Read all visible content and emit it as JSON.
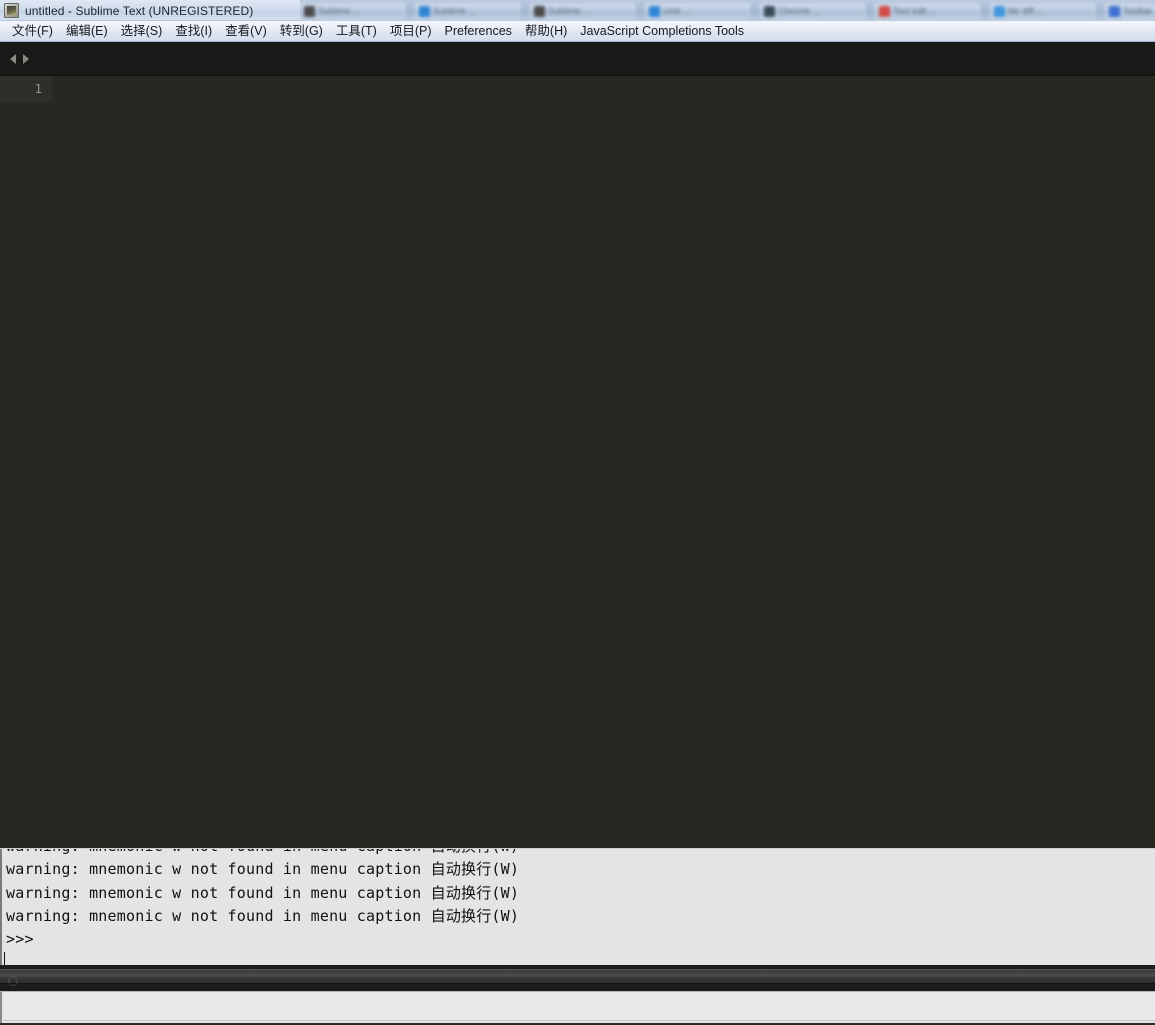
{
  "window": {
    "title": "untitled - Sublime Text (UNREGISTERED)",
    "app_icon": "sublime-text-icon"
  },
  "taskbar": {
    "background_windows": [
      {
        "label": "Sublime ..."
      },
      {
        "label": "Sublime ..."
      },
      {
        "label": "Sublime ..."
      },
      {
        "label": "cmd ..."
      },
      {
        "label": "Chrome ..."
      },
      {
        "label": "Tool edit ..."
      },
      {
        "label": "file diff ..."
      },
      {
        "label": "Toolbar"
      }
    ]
  },
  "menubar": {
    "items": [
      {
        "label": "文件(F)",
        "mnemonic": "F"
      },
      {
        "label": "编辑(E)",
        "mnemonic": "E"
      },
      {
        "label": "选择(S)",
        "mnemonic": "S"
      },
      {
        "label": "查找(I)",
        "mnemonic": "I"
      },
      {
        "label": "查看(V)",
        "mnemonic": "V"
      },
      {
        "label": "转到(G)",
        "mnemonic": "G"
      },
      {
        "label": "工具(T)",
        "mnemonic": "T"
      },
      {
        "label": "项目(P)",
        "mnemonic": "P"
      },
      {
        "label": "Preferences",
        "mnemonic": "n"
      },
      {
        "label": "帮助(H)",
        "mnemonic": "H"
      },
      {
        "label": "JavaScript Completions Tools",
        "mnemonic": "J"
      }
    ]
  },
  "tabbar": {
    "nav_prev": "chevron-left-icon",
    "nav_next": "chevron-right-icon",
    "tabs": []
  },
  "editor": {
    "line_numbers": [
      "1"
    ],
    "lines": [
      ""
    ],
    "background_color": "#272822",
    "gutter_color": "#2e2f28",
    "text_color": "#f8f8f2"
  },
  "console": {
    "lines": [
      "warning: mnemonic w not found in menu caption 自动换行(W)",
      "warning: mnemonic w not found in menu caption 自动换行(W)",
      "warning: mnemonic w not found in menu caption 自动换行(W)",
      "warning: mnemonic w not found in menu caption 自动换行(W)",
      ">>>"
    ],
    "prompt": ">>>",
    "background_color": "#e4e4e4",
    "text_color": "#111111"
  },
  "bottom_strip": {
    "value": "",
    "placeholder": ""
  }
}
